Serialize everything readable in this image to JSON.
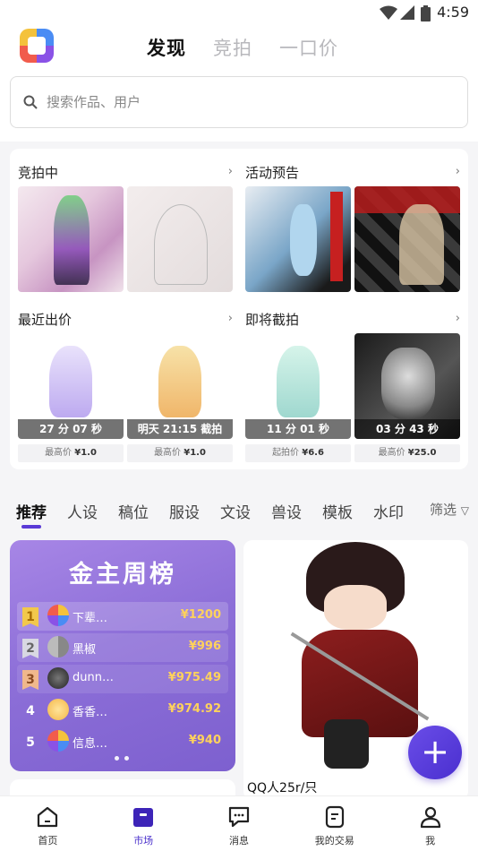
{
  "status_bar": {
    "time": "4:59"
  },
  "header": {
    "tabs": [
      {
        "label": "发现",
        "active": true
      },
      {
        "label": "竞拍"
      },
      {
        "label": "一口价"
      }
    ]
  },
  "search": {
    "placeholder": "搜索作品、用户"
  },
  "sections": {
    "bidding": {
      "title": "竞拍中"
    },
    "preview": {
      "title": "活动预告"
    },
    "recent": {
      "title": "最近出价",
      "items": [
        {
          "timer": "27 分 07 秒",
          "price_label": "最高价",
          "price": "¥1.0"
        },
        {
          "timer": "明天 21:15 截拍",
          "price_label": "最高价",
          "price": "¥1.0"
        }
      ]
    },
    "ending": {
      "title": "即将截拍",
      "items": [
        {
          "timer": "11 分 01 秒",
          "price_label": "起拍价",
          "price": "¥6.6"
        },
        {
          "timer": "03 分 43 秒",
          "price_label": "最高价",
          "price": "¥25.0"
        }
      ]
    }
  },
  "categories": [
    "推荐",
    "人设",
    "稿位",
    "服设",
    "文设",
    "兽设",
    "模板",
    "水印"
  ],
  "filter_label": "筛选",
  "rank": {
    "title": "金主周榜",
    "rows": [
      {
        "rank": "1",
        "name": "下辈…",
        "amount": "¥1200"
      },
      {
        "rank": "2",
        "name": "黑椒",
        "amount": "¥996"
      },
      {
        "rank": "3",
        "name": "dunn…",
        "amount": "¥975.49"
      },
      {
        "rank": "4",
        "name": "香香…",
        "amount": "¥974.92"
      },
      {
        "rank": "5",
        "name": "信息…",
        "amount": "¥940"
      }
    ]
  },
  "product": {
    "title": "QQ人25r/只"
  },
  "bottom_nav": [
    {
      "label": "首页",
      "icon": "home-icon"
    },
    {
      "label": "市场",
      "icon": "market-icon",
      "active": true
    },
    {
      "label": "消息",
      "icon": "message-icon"
    },
    {
      "label": "我的交易",
      "icon": "trade-icon"
    },
    {
      "label": "我",
      "icon": "profile-icon"
    }
  ],
  "colors": {
    "accent": "#4a30cc",
    "rank_gold": "#ffd25c"
  }
}
